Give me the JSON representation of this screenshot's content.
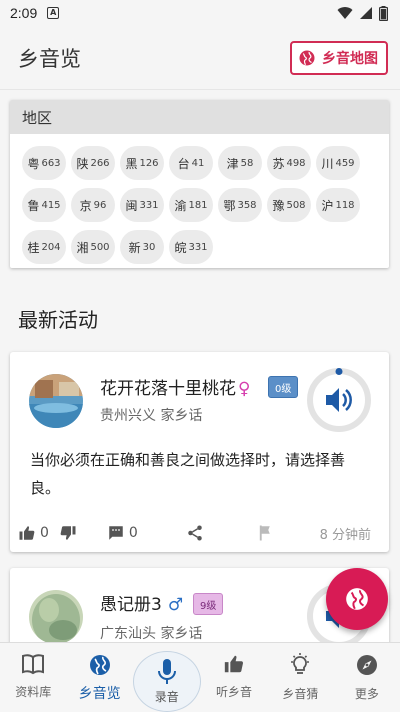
{
  "status": {
    "time": "2:09",
    "a_label": "A"
  },
  "app": {
    "title": "乡音览",
    "map_button": "乡音地图"
  },
  "regions": {
    "header": "地区",
    "items": [
      {
        "name": "粤",
        "count": "663"
      },
      {
        "name": "陕",
        "count": "266"
      },
      {
        "name": "黑",
        "count": "126"
      },
      {
        "name": "台",
        "count": "41"
      },
      {
        "name": "津",
        "count": "58"
      },
      {
        "name": "苏",
        "count": "498"
      },
      {
        "name": "川",
        "count": "459"
      },
      {
        "name": "鲁",
        "count": "415"
      },
      {
        "name": "京",
        "count": "96"
      },
      {
        "name": "闽",
        "count": "331"
      },
      {
        "name": "渝",
        "count": "181"
      },
      {
        "name": "鄂",
        "count": "358"
      },
      {
        "name": "豫",
        "count": "508"
      },
      {
        "name": "沪",
        "count": "118"
      },
      {
        "name": "桂",
        "count": "204"
      },
      {
        "name": "湘",
        "count": "500"
      },
      {
        "name": "新",
        "count": "30"
      },
      {
        "name": "皖",
        "count": "331"
      }
    ]
  },
  "latest": {
    "title": "最新活动",
    "activities": [
      {
        "name": "花开花落十里桃花",
        "gender_symbol": "♀",
        "level": "0级",
        "location": "贵州兴义 家乡话",
        "text": "当你必须在正确和善良之间做选择时，请选择善良。",
        "likes": "0",
        "dislikes": "",
        "comments": "0",
        "time_ago": "8 分钟前"
      },
      {
        "name": "愚记册3",
        "gender_symbol": "♂",
        "level": "9级",
        "location": "广东汕头 家乡话"
      }
    ]
  },
  "nav": {
    "items": [
      "资料库",
      "乡音览",
      "录音",
      "听乡音",
      "乡音猜",
      "更多"
    ]
  },
  "colors": {
    "accent": "#d12c54",
    "nav_active": "#1c5fa8",
    "play": "#1e5aa6"
  }
}
